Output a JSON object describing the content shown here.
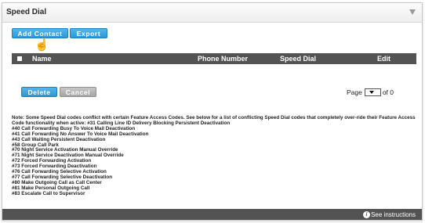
{
  "panel": {
    "title": "Speed Dial"
  },
  "toolbar": {
    "add_contact": "Add Contact",
    "export": "Export"
  },
  "table": {
    "columns": [
      "Name",
      "Phone Number",
      "Speed Dial",
      "Edit"
    ]
  },
  "actions": {
    "delete": "Delete",
    "cancel": "Cancel"
  },
  "pager": {
    "label": "Page",
    "of": "of 0"
  },
  "note": {
    "intro": "Note: Some Speed Dial codes conflict with certain Feature Access Codes. See below for a list of conflicting Speed Dial codes that completely over-ride their Feature Access Code functionality when active: #31 Calling Line ID Delivery Blocking Persistent Deactivation",
    "lines": [
      "#40 Call Forwarding Busy To Voice Mail Deactivation",
      "#41 Call Forwarding No Answer To Voice Mail Deactivation",
      "#43 Call Waiting Persistent Deactivation",
      "#58 Group Call Park",
      "#70 Night Service Activation Manual Override",
      "#71 Night Service Deactivation Manual Override",
      "#72 Forced Forwarding Activation",
      "#73 Forced Forwarding Deactivation",
      "#76 Call Forwarding Selective Activation",
      "#77 Call Forwarding Selective Deactivation",
      "#80 Make Outgoing Call as Call Center",
      "#81 Make Personal Outgoing Call",
      "#83 Escalate Call to Supervisor"
    ]
  },
  "footer": {
    "instructions": "See instructions",
    "info_icon": "info-icon"
  },
  "colors": {
    "button_blue": "#2d97d6",
    "button_grey": "#a6a6a6",
    "header_bar": "#535353"
  }
}
